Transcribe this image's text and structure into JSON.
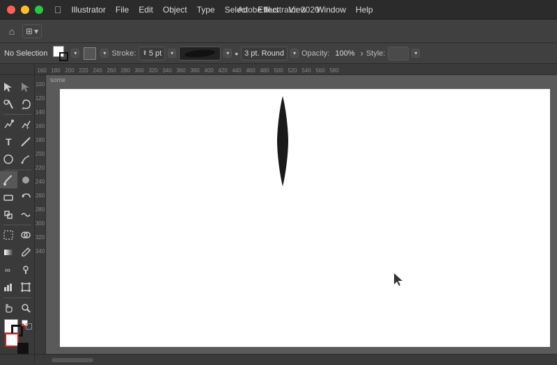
{
  "titleBar": {
    "appName": "Illustrator",
    "menuItems": [
      "Illustrator",
      "File",
      "Edit",
      "Object",
      "Type",
      "Select",
      "Effect",
      "View",
      "Window",
      "Help"
    ],
    "windowTitle": "Adobe Illustrator 2020"
  },
  "controlBar": {
    "homeIcon": "⌂",
    "workspaceIcon": "⊞",
    "workspaceArrow": "▾"
  },
  "propertiesBar": {
    "noSelection": "No Selection",
    "stroke": "Stroke:",
    "strokeValue": "5 pt",
    "dotLabel": "•",
    "brushSize": "3 pt. Round",
    "opacity": "Opacity:",
    "opacityValue": "100%",
    "arrowRight": "›",
    "style": "Style:"
  },
  "canvas": {
    "label": "some"
  },
  "ruler": {
    "topTicks": [
      "160",
      "180",
      "200",
      "220",
      "240",
      "260",
      "280",
      "300",
      "320",
      "340",
      "360",
      "380",
      "400",
      "420",
      "440",
      "460",
      "480",
      "500",
      "520",
      "540",
      "560",
      "580"
    ]
  },
  "tools": [
    {
      "name": "selection-tool",
      "icon": "▶",
      "active": false
    },
    {
      "name": "direct-selection-tool",
      "icon": "↖",
      "active": false
    },
    {
      "name": "magic-wand-tool",
      "icon": "✦",
      "active": false
    },
    {
      "name": "lasso-tool",
      "icon": "⌾",
      "active": false
    },
    {
      "name": "pen-tool",
      "icon": "✒",
      "active": false
    },
    {
      "name": "anchor-tool",
      "icon": "+✒",
      "active": false
    },
    {
      "name": "type-tool",
      "icon": "T",
      "active": false
    },
    {
      "name": "line-tool",
      "icon": "╱",
      "active": false
    },
    {
      "name": "ellipse-tool",
      "icon": "○",
      "active": false
    },
    {
      "name": "pencil-tool",
      "icon": "✏",
      "active": false
    },
    {
      "name": "paintbrush-tool",
      "icon": "🖌",
      "active": true
    },
    {
      "name": "blob-brush-tool",
      "icon": "⬤",
      "active": false
    },
    {
      "name": "eraser-tool",
      "icon": "◻",
      "active": false
    },
    {
      "name": "rotate-tool",
      "icon": "↻",
      "active": false
    },
    {
      "name": "scale-tool",
      "icon": "⤡",
      "active": false
    },
    {
      "name": "warp-tool",
      "icon": "〜",
      "active": false
    },
    {
      "name": "free-transform-tool",
      "icon": "⊡",
      "active": false
    },
    {
      "name": "shape-builder-tool",
      "icon": "⊕",
      "active": false
    },
    {
      "name": "gradient-tool",
      "icon": "▦",
      "active": false
    },
    {
      "name": "graph-tool",
      "icon": "📊",
      "active": false
    },
    {
      "name": "eyedropper-tool",
      "icon": "💉",
      "active": false
    },
    {
      "name": "blend-tool",
      "icon": "∞",
      "active": false
    },
    {
      "name": "symbol-tool",
      "icon": "✾",
      "active": false
    },
    {
      "name": "column-graph-tool",
      "icon": "▮",
      "active": false
    },
    {
      "name": "artboard-tool",
      "icon": "⊟",
      "active": false
    },
    {
      "name": "slice-tool",
      "icon": "✂",
      "active": false
    },
    {
      "name": "hand-tool",
      "icon": "✋",
      "active": false
    },
    {
      "name": "zoom-tool",
      "icon": "🔍",
      "active": false
    }
  ],
  "colors": {
    "bg": "#3a3a3a",
    "toolbar": "#3a3a3a",
    "titlebar": "#2b2b2b",
    "propertiesBar": "#404040",
    "canvas": "#ffffff",
    "accent": "#ff5f57"
  }
}
